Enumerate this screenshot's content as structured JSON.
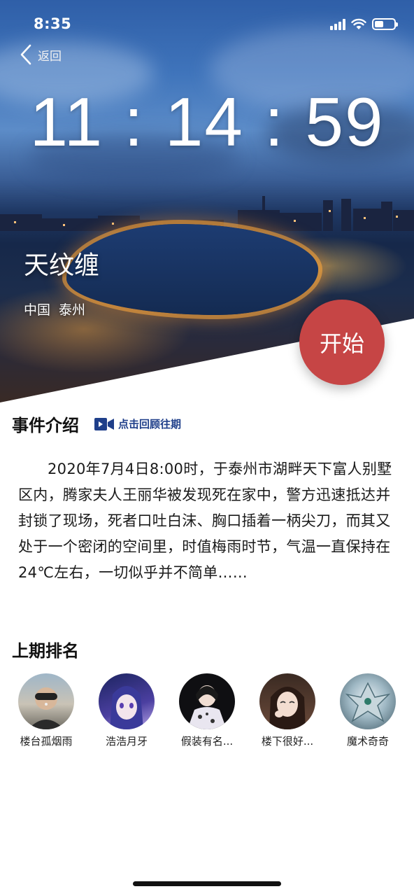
{
  "status_bar": {
    "time": "8:35",
    "signal_icon": "cellular-signal-icon",
    "wifi_icon": "wifi-icon",
    "battery_icon": "battery-icon",
    "battery_level": 0.45
  },
  "nav": {
    "back_label": "返回",
    "back_icon": "chevron-left-icon"
  },
  "hero": {
    "countdown": "11 : 14 : 59",
    "title": "天纹缠",
    "location": {
      "country": "中国",
      "city": "泰州"
    },
    "start_label": "开始"
  },
  "event": {
    "heading": "事件介绍",
    "replay_icon": "video-camera-icon",
    "replay_label": "点击回顾往期",
    "description": "2020年7月4日8:00时，于泰州市湖畔天下富人别墅区内，腾家夫人王丽华被发现死在家中，警方迅速抵达并封锁了现场，死者口吐白沫、胸口插着一柄尖刀，而其又处于一个密闭的空间里，时值梅雨时节，气温一直保持在24℃左右，一切似乎并不简单……"
  },
  "ranking": {
    "heading": "上期排名",
    "players": [
      {
        "name": "楼台孤烟雨"
      },
      {
        "name": "浩浩月牙"
      },
      {
        "name": "假装有名..."
      },
      {
        "name": "楼下很好..."
      },
      {
        "name": "魔术奇奇"
      }
    ]
  },
  "colors": {
    "accent_red": "#c64545",
    "link_blue": "#1f3f8a"
  }
}
